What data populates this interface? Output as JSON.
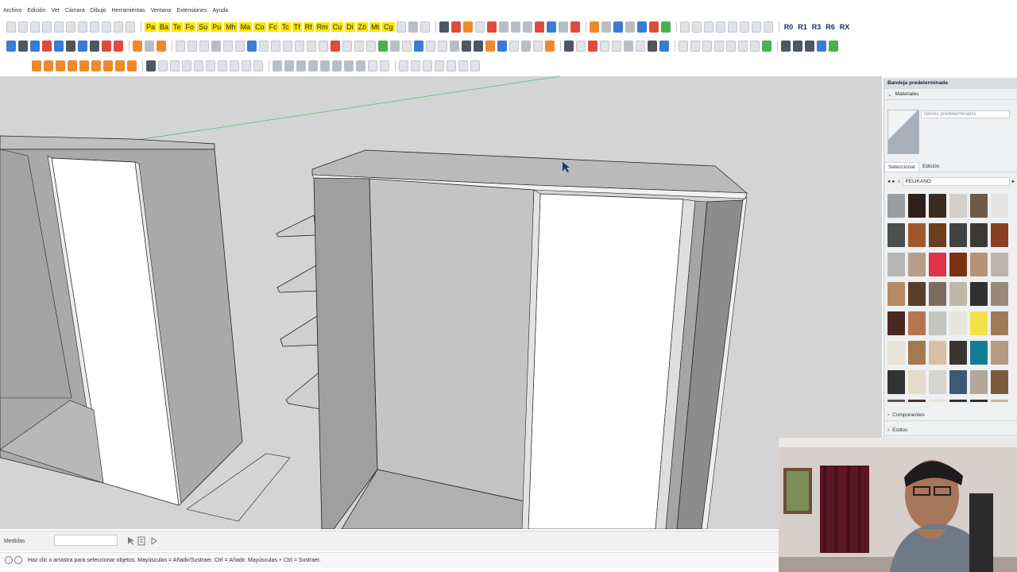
{
  "menu": {
    "items": [
      "Archivo",
      "Edición",
      "Ver",
      "Cámara",
      "Dibujo",
      "Herramientas",
      "Ventana",
      "Extensiones",
      "Ayuda"
    ]
  },
  "toolbar1": {
    "labels": [
      "Pa",
      "Ba",
      "Te",
      "Fo",
      "Su",
      "Pu",
      "Mh",
      "Ma",
      "Co",
      "Fc",
      "Tc",
      "Tf",
      "Rf",
      "Rm",
      "Cu",
      "Di",
      "Zö",
      "Mt",
      "Cg"
    ],
    "rotate_labels": [
      "R0",
      "R1",
      "R3",
      "R6",
      "RX"
    ]
  },
  "tray": {
    "title": "Bandeja predeterminada",
    "materials_label": "Materiales",
    "material_name": "Valores predeterminados",
    "tab_select": "Seleccionar",
    "tab_edit": "Edición",
    "library": "PELIKANO",
    "components_label": "Componentes",
    "styles_label": "Estilos",
    "swatch_colors": [
      "#9b9ea0",
      "#2e211a",
      "#3a2a20",
      "#d3cfca",
      "#6e5a47",
      "#e6e5e3",
      "#4b4f4d",
      "#a0582a",
      "#6a3f1e",
      "#414342",
      "#3c3935",
      "#8a3f22",
      "#b7b9b7",
      "#b79e88",
      "#e0344a",
      "#7a3310",
      "#b59278",
      "#bdb5ad",
      "#b58a62",
      "#5a3d2a",
      "#7b6c5e",
      "#c2b8aa",
      "#2f3032",
      "#9a8878",
      "#4a2a20",
      "#b5764e",
      "#c4c4c0",
      "#e9e7dd",
      "#f5e24a",
      "#a07a56",
      "#e7e3da",
      "#a57850",
      "#d8c0a5",
      "#3a3431",
      "#127e95",
      "#b49a7e",
      "#323335",
      "#e3dccb",
      "#d6d4d0",
      "#3e5878",
      "#b3a79a",
      "#7a5a3c",
      "#5a5451",
      "#4a3424",
      "#e6dfd2",
      "#2e2f31",
      "#2b2c2e",
      "#c8b49d"
    ]
  },
  "measure": {
    "label": "Medidas",
    "value": ""
  },
  "status": {
    "text": "Haz clic o arrastra para seleccionar objetos. Mayúsculas = Añadir/Sustraer. Ctrl = Añadir. Mayúsculas + Ctrl = Sustraer."
  }
}
